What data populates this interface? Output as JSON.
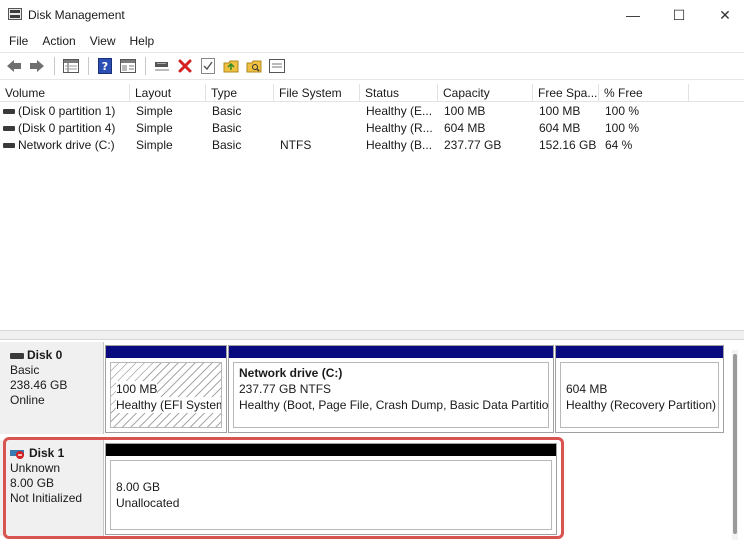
{
  "window": {
    "title": "Disk Management",
    "controls": [
      "—",
      "☐",
      "✕"
    ]
  },
  "menu": [
    "File",
    "Action",
    "View",
    "Help"
  ],
  "toolbar": {
    "icons": [
      "back-icon",
      "forward-icon",
      "list-view-icon",
      "help-icon",
      "properties-icon",
      "connect-icon",
      "delete-icon",
      "checkmark-icon",
      "up-folder-icon",
      "search-folder-icon",
      "console-icon"
    ]
  },
  "volume_list": {
    "columns": [
      "Volume",
      "Layout",
      "Type",
      "File System",
      "Status",
      "Capacity",
      "Free Spa...",
      "% Free"
    ],
    "rows": [
      {
        "volume": "(Disk 0 partition 1)",
        "layout": "Simple",
        "type": "Basic",
        "fs": "",
        "status": "Healthy (E...",
        "capacity": "100 MB",
        "free": "100 MB",
        "pct": "100 %"
      },
      {
        "volume": "(Disk 0 partition 4)",
        "layout": "Simple",
        "type": "Basic",
        "fs": "",
        "status": "Healthy (R...",
        "capacity": "604 MB",
        "free": "604 MB",
        "pct": "100 %"
      },
      {
        "volume": "Network drive  (C:)",
        "layout": "Simple",
        "type": "Basic",
        "fs": "NTFS",
        "status": "Healthy (B...",
        "capacity": "237.77 GB",
        "free": "152.16 GB",
        "pct": "64 %"
      }
    ]
  },
  "disks": [
    {
      "name": "Disk 0",
      "type": "Basic",
      "size": "238.46 GB",
      "state": "Online",
      "partitions": [
        {
          "line1": "",
          "line2": "100 MB",
          "line3": "Healthy (EFI System"
        },
        {
          "line1": "Network drive  (C:)",
          "line2": "237.77 GB NTFS",
          "line3": "Healthy (Boot, Page File, Crash Dump, Basic Data Partition)"
        },
        {
          "line1": "",
          "line2": "604 MB",
          "line3": "Healthy (Recovery Partition)"
        }
      ]
    },
    {
      "name": "Disk 1",
      "type": "Unknown",
      "size": "8.00 GB",
      "state": "Not Initialized",
      "partitions": [
        {
          "line1": "",
          "line2": "8.00 GB",
          "line3": "Unallocated"
        }
      ]
    }
  ],
  "colors": {
    "primary_partition_bar": "#0a0a80",
    "unallocated_bar": "#000000",
    "highlight_border": "#d9534f"
  }
}
